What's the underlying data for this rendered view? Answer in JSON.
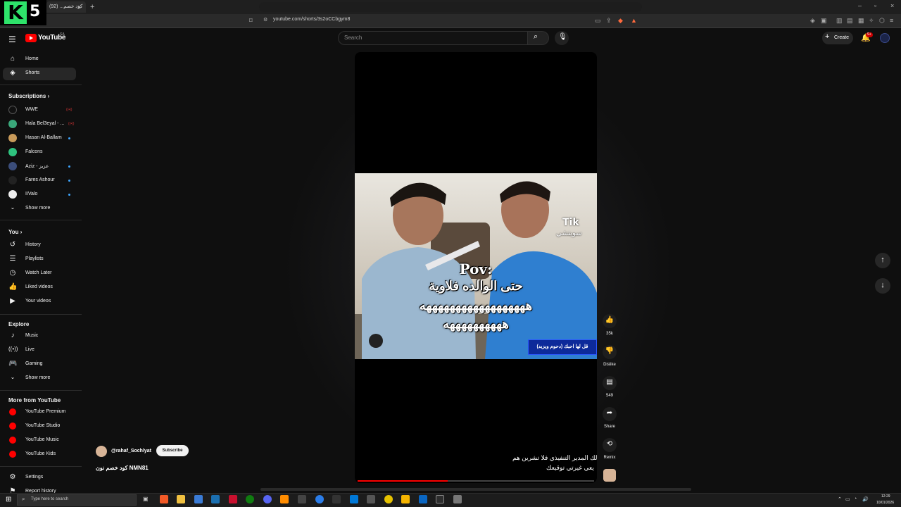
{
  "browser": {
    "tab_title": "كود خصم... (92)",
    "tab_close": "×",
    "new_tab": "+",
    "url": "youtube.com/shorts/3s2oCCbgym8",
    "window_controls": [
      "–",
      "▫",
      "×"
    ]
  },
  "overlay_logo": {
    "letter": "K",
    "number": "5"
  },
  "header": {
    "logo_text": "YouTube",
    "country_code": "SA",
    "search_placeholder": "Search",
    "create_label": "Create",
    "notifications_badge": "9+"
  },
  "sidebar": {
    "main": [
      {
        "label": "Home",
        "icon": "home-icon"
      },
      {
        "label": "Shorts",
        "icon": "shorts-icon",
        "active": true
      }
    ],
    "subscriptions_heading": "Subscriptions",
    "subscriptions": [
      {
        "name": "WWE",
        "status": "live"
      },
      {
        "name": "Hala Bel3eyal - ...",
        "status": "live"
      },
      {
        "name": "Hasan Al-Ballam",
        "status": "new"
      },
      {
        "name": "Falcons",
        "status": ""
      },
      {
        "name": "Aziz - عزيز",
        "status": "new"
      },
      {
        "name": "Fares Ashour",
        "status": "new"
      },
      {
        "name": "IIValo",
        "status": "new"
      }
    ],
    "subs_show_more": "Show more",
    "you_heading": "You",
    "you_items": [
      "History",
      "Playlists",
      "Watch Later",
      "Liked videos",
      "Your videos"
    ],
    "explore_heading": "Explore",
    "explore_items": [
      "Music",
      "Live",
      "Gaming"
    ],
    "explore_show_more": "Show more",
    "more_heading": "More from YouTube",
    "more_items": [
      "YouTube Premium",
      "YouTube Studio",
      "YouTube Music",
      "YouTube Kids"
    ],
    "settings": "Settings",
    "report_history": "Report history"
  },
  "video": {
    "overlay_pov": "Pov:",
    "overlay_line1": "حتى الوالده فلاوية",
    "overlay_line2": "ههههههههههههههههههه",
    "overlay_line3": "ههههههههههه",
    "watermark_1": "Tik",
    "watermark_2": "سويتشي",
    "lower_banner": "قل لها احبك (دحوم ويزيد)",
    "title_line1": "لك المدير التنفيذي فلا تشرين هم",
    "title_line2": "يعي غيرتي توقيعك",
    "progress_fraction": 0.38
  },
  "channel": {
    "handle": "@rahaf_Sochlyat",
    "subscribe_label": "Subscribe",
    "short_title": "كود خصم نون NMN81"
  },
  "actions": {
    "likes": "35k",
    "dislike": "Dislike",
    "comments": "549",
    "share": "Share",
    "remix": "Remix"
  },
  "taskbar": {
    "search_placeholder": "Type here to search",
    "time": "12:29",
    "date": "10/01/2026"
  },
  "colors": {
    "brand": "#ff0000",
    "background": "#0f0f0f",
    "accent_blue": "#3ea6ff",
    "logo_green": "#2ee26a"
  }
}
